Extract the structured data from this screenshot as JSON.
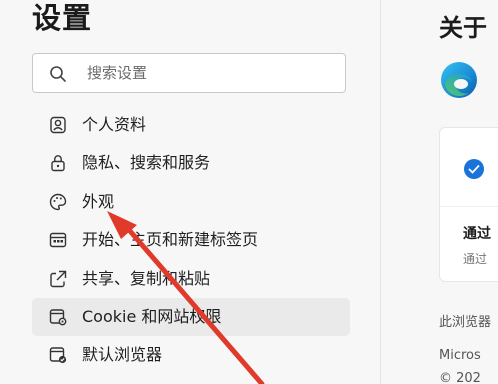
{
  "page_title": "设置",
  "search": {
    "placeholder": "搜索设置"
  },
  "menu": [
    {
      "label": "个人资料",
      "icon": "profile-icon"
    },
    {
      "label": "隐私、搜索和服务",
      "icon": "lock-icon"
    },
    {
      "label": "外观",
      "icon": "palette-icon"
    },
    {
      "label": "开始、主页和新建标签页",
      "icon": "start-page-icon"
    },
    {
      "label": "共享、复制和粘贴",
      "icon": "share-icon"
    },
    {
      "label": "Cookie 和网站权限",
      "icon": "site-permissions-icon",
      "active": true
    },
    {
      "label": "默认浏览器",
      "icon": "default-browser-icon"
    }
  ],
  "about": {
    "title": "关于",
    "card_heading": "通过",
    "card_sub": "通过",
    "text1": "此浏览器",
    "text2": "Micros",
    "text3": "© 202"
  },
  "colors": {
    "background": "#f7f7f7",
    "active_item": "#eaeaea",
    "accent_blue": "#1a73d8",
    "arrow_red": "#e03a2a"
  }
}
